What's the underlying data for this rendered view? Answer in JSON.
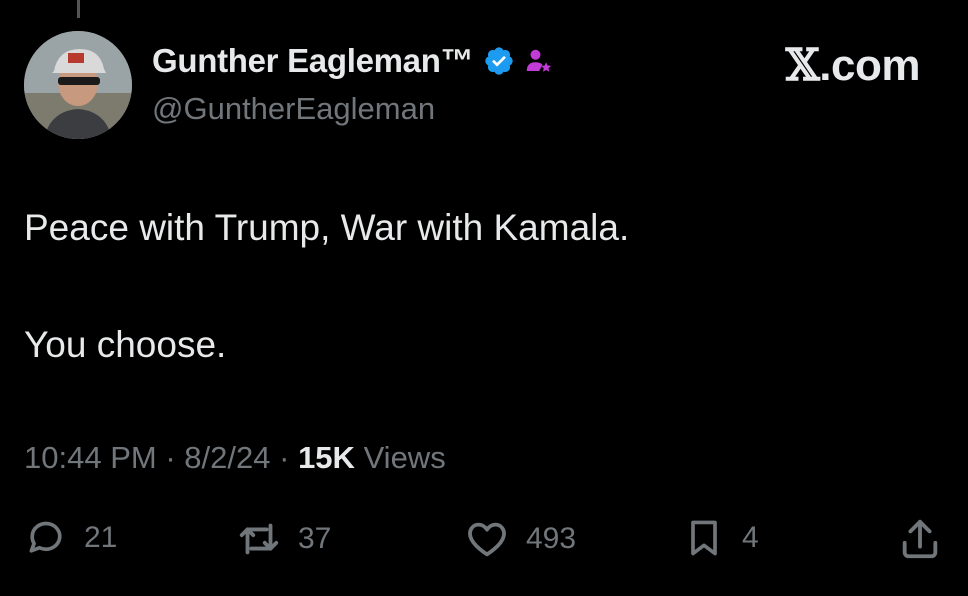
{
  "author": {
    "display_name": "Gunther Eagleman™",
    "handle": "@GuntherEagleman",
    "verified": true,
    "colors": {
      "verified_badge": "#1d9bf0",
      "affiliate_badge": "#c13bd6"
    }
  },
  "brand": {
    "x_glyph": "𝕏",
    "suffix": ".com"
  },
  "tweet": {
    "line1": "Peace with Trump, War with Kamala.",
    "line2": "You choose."
  },
  "meta": {
    "time": "10:44 PM",
    "separator": "·",
    "date": "8/2/24",
    "views_count": "15K",
    "views_label": "Views"
  },
  "actions": {
    "replies": "21",
    "reposts": "37",
    "likes": "493",
    "bookmarks": "4"
  },
  "icons": [
    "reply-icon",
    "repost-icon",
    "like-icon",
    "bookmark-icon",
    "share-icon",
    "verified-icon",
    "affiliate-icon"
  ]
}
